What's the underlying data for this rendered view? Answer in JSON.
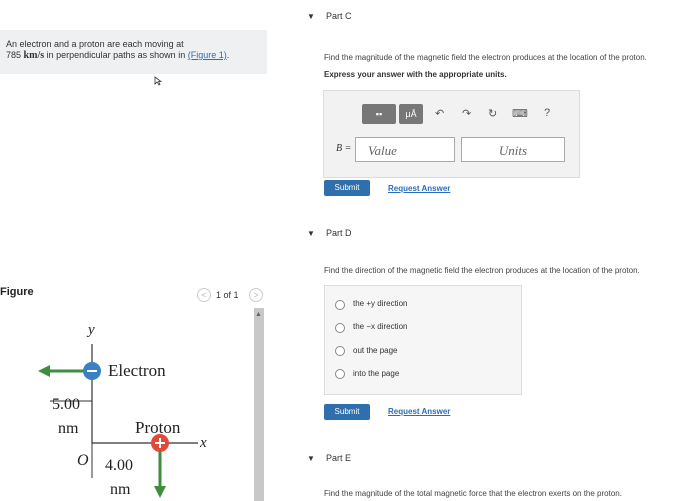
{
  "problem": {
    "line1": "An electron and a proton are each moving at",
    "speed_value": "785",
    "speed_unit": "km/s",
    "line2_rest": " in perpendicular paths as shown in ",
    "figure_link": "(Figure 1)",
    "line2_end": "."
  },
  "figure_panel": {
    "label": "Figure",
    "pager_prev": "<",
    "pager_text": "1 of 1",
    "pager_next": ">",
    "scroll_up": "▲"
  },
  "figure": {
    "y_axis": "y",
    "x_axis": "x",
    "electron_label": "Electron",
    "electron_sign": "−",
    "proton_label": "Proton",
    "proton_sign": "+",
    "origin": "O",
    "vert_distance": "5.00",
    "vert_unit": "nm",
    "horiz_distance": "4.00",
    "horiz_unit": "nm",
    "electron_color": "#3b7fc4",
    "proton_color": "#e04a3a",
    "arrow_color": "#3e8e3e"
  },
  "part_c": {
    "title": "Part C",
    "question": "Find the magnitude of the magnetic field the electron produces at the location of the proton.",
    "instruction": "Express your answer with the appropriate units.",
    "toolbar": {
      "templates": "▪▪",
      "units": "μÅ",
      "undo": "↶",
      "redo": "↷",
      "reset": "↻",
      "keyboard": "⌨",
      "help": "?"
    },
    "variable_label": "B =",
    "value_placeholder": "Value",
    "units_placeholder": "Units",
    "submit": "Submit",
    "request_answer": "Request Answer"
  },
  "part_d": {
    "title": "Part D",
    "question": "Find the direction of the magnetic field the electron produces at the location of the proton.",
    "choices": [
      "the +y direction",
      "the −x direction",
      "out the page",
      "into the page"
    ],
    "submit": "Submit",
    "request_answer": "Request Answer"
  },
  "part_e": {
    "title": "Part E",
    "question": "Find the magnitude of the total magnetic force that the electron exerts on the proton."
  },
  "collapse_icon": "▼"
}
